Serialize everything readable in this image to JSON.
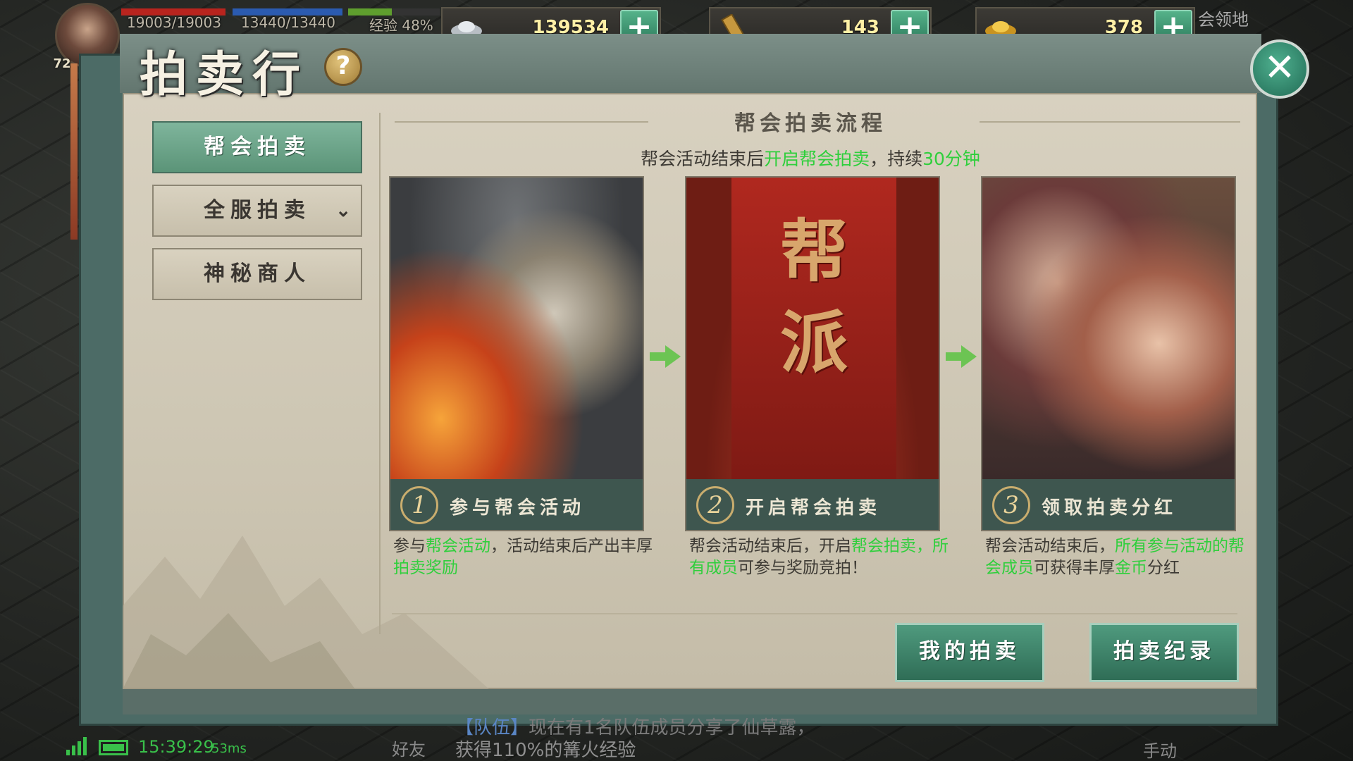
{
  "hud": {
    "level": "72",
    "hp": "19003/19003",
    "mp": "13440/13440",
    "exp": "经验 48%",
    "exp_fraction": 0.48,
    "silver": "139534",
    "scroll": "143",
    "gold": "378",
    "add_label": "+",
    "top_right_text": "会领地"
  },
  "window": {
    "title": "拍卖行",
    "help_label": "?",
    "close_label": "✕"
  },
  "tabs": [
    {
      "label": "帮会拍卖",
      "active": true
    },
    {
      "label": "全服拍卖",
      "chevron": "⌄"
    },
    {
      "label": "神秘商人"
    }
  ],
  "flow": {
    "title": "帮会拍卖流程",
    "intro": {
      "a": "帮会活动结束后",
      "b": "开启帮会拍卖",
      "c": "，持续",
      "d": "30分钟"
    },
    "banner_text": "帮\n派",
    "steps": [
      {
        "num": "1",
        "label": "参与帮会活动",
        "desc": [
          "参与",
          "帮会活动",
          "，活动结束后产出丰厚",
          "拍卖奖励"
        ]
      },
      {
        "num": "2",
        "label": "开启帮会拍卖",
        "desc": [
          "帮会活动结束后，开启",
          "帮会拍卖",
          "，所有成员",
          "可参与奖励竞拍！"
        ]
      },
      {
        "num": "3",
        "label": "领取拍卖分红",
        "desc": [
          "帮会活动结束后，",
          "所有参与活动的帮会成员",
          "可获得丰厚",
          "金币",
          "分红"
        ]
      }
    ]
  },
  "actions": {
    "my_auction": "我的拍卖",
    "auction_log": "拍卖纪录"
  },
  "bottom": {
    "time": "15:39:29",
    "ping": "53ms",
    "friend": "好友",
    "chat_tag": "【队伍】",
    "chat_line1": "现在有1名队伍成员分享了仙草露，",
    "chat_line2": "获得110%的篝火经验",
    "manual": "手动"
  },
  "colors": {
    "highlight": "#2fcf3c",
    "accent": "#4f9a7e"
  }
}
